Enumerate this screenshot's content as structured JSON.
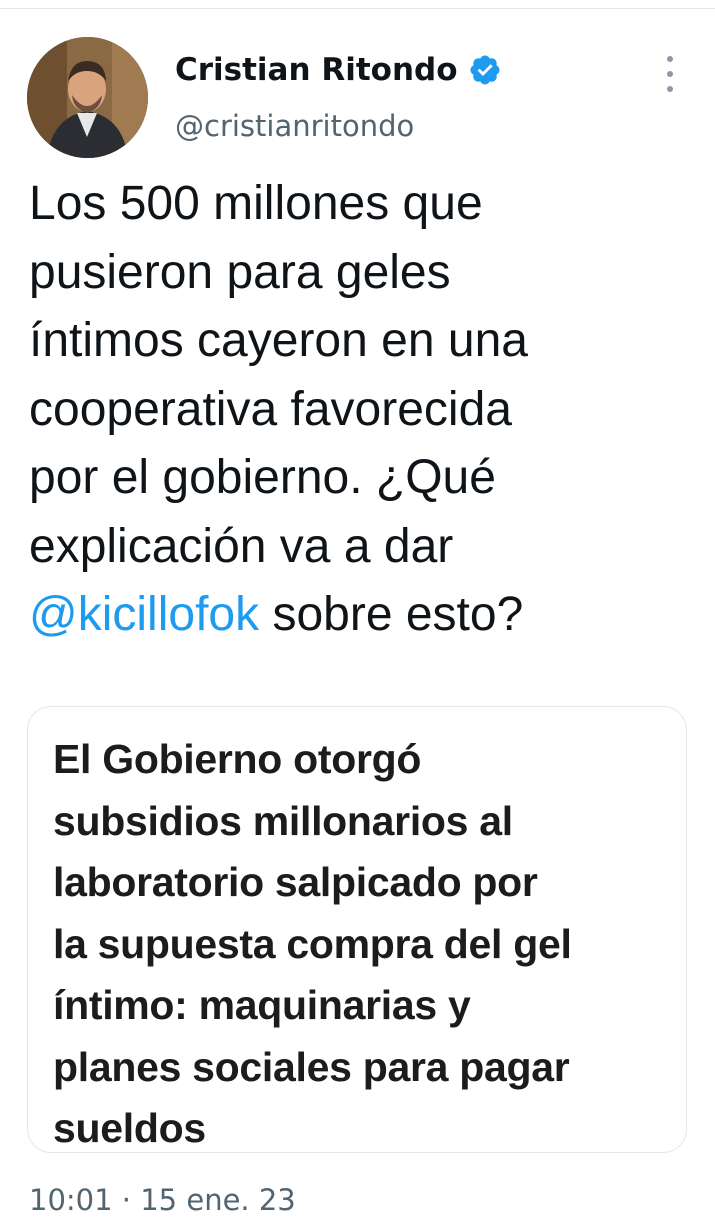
{
  "user": {
    "display_name": "Cristian Ritondo",
    "handle": "@cristianritondo",
    "verified": true,
    "avatar_icon": "profile-photo"
  },
  "tweet": {
    "lines": [
      "Los 500 millones que",
      "pusieron para geles",
      "íntimos cayeron en una",
      "cooperativa favorecida",
      "por el gobierno. ¿Qué",
      "explicación va a dar"
    ],
    "mention": "@kicillofok",
    "last_line_rest": " sobre esto?"
  },
  "card": {
    "title_lines": [
      "El Gobierno otorgó",
      "subsidios millonarios al",
      "laboratorio salpicado por",
      "la supuesta compra del gel",
      "íntimo: maquinarias y",
      "planes sociales para pagar",
      "sueldos"
    ]
  },
  "timestamp": "10:01 · 15 ene. 23",
  "colors": {
    "accent": "#1d9bf0",
    "text": "#0f1419",
    "secondary": "#536471"
  },
  "icons": {
    "verified": "verified-badge-icon",
    "more": "more-options-icon"
  }
}
